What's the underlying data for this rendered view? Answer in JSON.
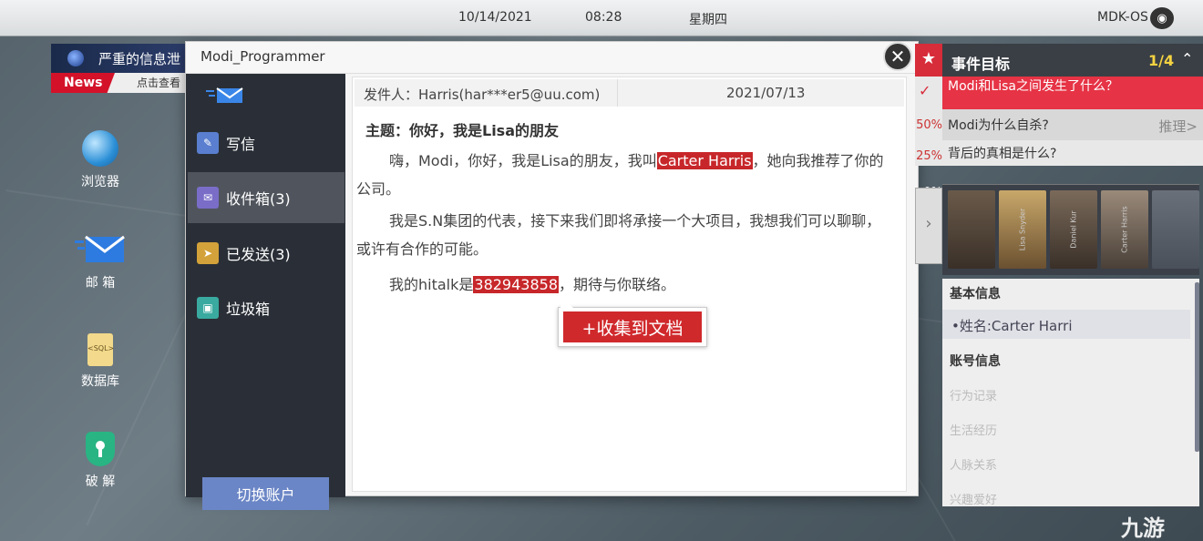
{
  "topbar": {
    "date": "10/14/2021",
    "time": "08:28",
    "weekday": "星期四",
    "os_name": "MDK-OS"
  },
  "news": {
    "headline": "严重的信息泄",
    "tag": "News",
    "sub": "点击查看"
  },
  "desktop": {
    "icons": [
      {
        "label": "浏览器"
      },
      {
        "label": "邮 箱"
      },
      {
        "label": "数据库",
        "icon_text": "<SQL>"
      },
      {
        "label": "破 解"
      }
    ]
  },
  "mail_window": {
    "title": "Modi_Programmer",
    "sidebar": {
      "items": [
        {
          "label": "写信",
          "color": "#5a7fd0"
        },
        {
          "label": "收件箱(3)",
          "color": "#7a6dc8"
        },
        {
          "label": "已发送(3)",
          "color": "#d4a23a"
        },
        {
          "label": "垃圾箱",
          "color": "#3aaaa0"
        }
      ],
      "switch_account": "切换账户"
    },
    "email": {
      "sender": "发件人：Harris(har***er5@uu.com)",
      "date": "2021/07/13",
      "subject": "主题：你好，我是Lisa的朋友",
      "p1_before": "嗨，Modi，你好，我是Lisa的朋友，我叫",
      "p1_highlight": "Carter Harris",
      "p1_after": "，她向我推荐了你的公司。",
      "p2": "我是S.N集团的代表，接下来我们即将承接一个大项目，我想我们可以聊聊，或许有合作的可能。",
      "p3_before": "我的hitalk是",
      "p3_highlight": "382943858",
      "p3_after": "，期待与你联络。"
    },
    "collect_button": "+收集到文档",
    "close_icon": "✕"
  },
  "objectives": {
    "title": "事件目标",
    "count": "1/4",
    "items": [
      {
        "text": "Modi和Lisa之间发生了什么？",
        "pct": ""
      },
      {
        "text": "Modi为什么自杀?",
        "pct": "50%",
        "action": "推理>"
      },
      {
        "text": "背后的真相是什么?",
        "pct": "25%"
      }
    ],
    "extra_pct": "0%"
  },
  "profile": {
    "names": [
      "Lisa Snyder",
      "Daniel Kur",
      "Carter Harris"
    ],
    "basic_info_title": "基本信息",
    "name_field": "•姓名:Carter Harri",
    "account_title": "账号信息",
    "fields": [
      "行为记录",
      "生活经历",
      "人脉关系",
      "兴趣爱好"
    ]
  },
  "brand": "九游"
}
